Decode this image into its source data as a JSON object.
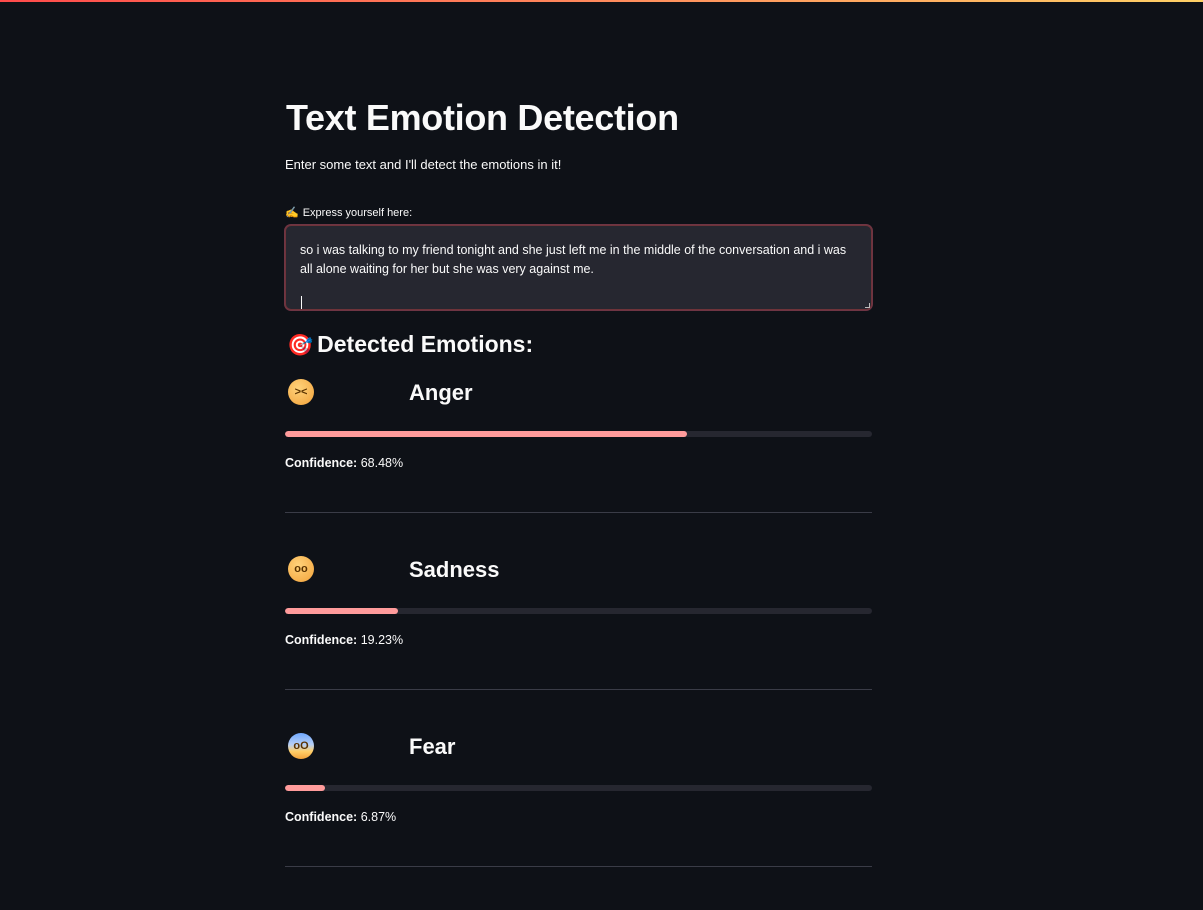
{
  "header": {
    "title": "Text Emotion Detection",
    "subtitle": "Enter some text and I'll detect the emotions in it!"
  },
  "input": {
    "label_emoji": "✍️",
    "label": "Express yourself here:",
    "value": "so i was talking to my friend tonight and she just left me in the middle of the conversation and i was all alone waiting for her but she was very against me."
  },
  "results": {
    "heading_emoji": "🎯",
    "heading": "Detected Emotions:",
    "confidence_label": "Confidence:",
    "items": [
      {
        "name": "Anger",
        "icon": "angry-face-icon",
        "confidence": 68.48,
        "confidence_text": "68.48%"
      },
      {
        "name": "Sadness",
        "icon": "sad-face-icon",
        "confidence": 19.23,
        "confidence_text": "19.23%"
      },
      {
        "name": "Fear",
        "icon": "fearful-face-icon",
        "confidence": 6.87,
        "confidence_text": "6.87%"
      }
    ]
  },
  "colors": {
    "background": "#0e1117",
    "progress_fill": "#ff9b9b",
    "progress_track": "#262730",
    "accent": "#ff4b4b"
  }
}
